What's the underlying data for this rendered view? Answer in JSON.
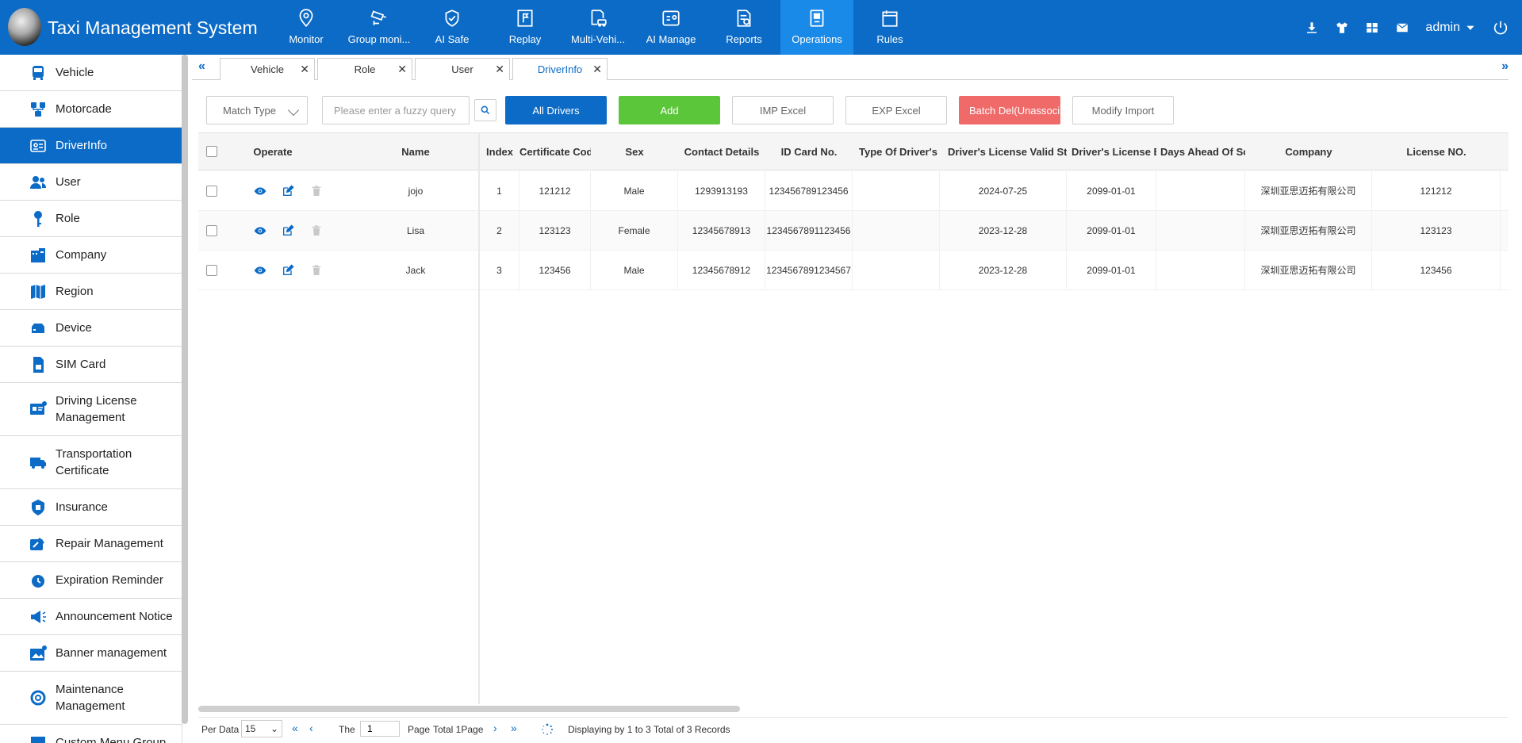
{
  "app": {
    "title": "Taxi Management System"
  },
  "nav": [
    {
      "label": "Monitor",
      "icon": "location-pin-icon"
    },
    {
      "label": "Group moni...",
      "icon": "cctv-camera-icon"
    },
    {
      "label": "AI Safe",
      "icon": "shield-check-icon"
    },
    {
      "label": "Replay",
      "icon": "replay-flag-icon"
    },
    {
      "label": "Multi-Vehi...",
      "icon": "vehicle-doc-icon"
    },
    {
      "label": "AI Manage",
      "icon": "ai-card-icon"
    },
    {
      "label": "Reports",
      "icon": "report-icon"
    },
    {
      "label": "Operations",
      "icon": "operations-icon",
      "active": true
    },
    {
      "label": "Rules",
      "icon": "rules-icon"
    }
  ],
  "header_right": {
    "user": "admin"
  },
  "sidebar": [
    {
      "label": "Vehicle",
      "icon": "bus-icon"
    },
    {
      "label": "Motorcade",
      "icon": "motorcade-icon"
    },
    {
      "label": "DriverInfo",
      "icon": "driver-card-icon",
      "active": true
    },
    {
      "label": "User",
      "icon": "users-icon"
    },
    {
      "label": "Role",
      "icon": "key-icon"
    },
    {
      "label": "Company",
      "icon": "company-icon"
    },
    {
      "label": "Region",
      "icon": "map-icon"
    },
    {
      "label": "Device",
      "icon": "device-icon"
    },
    {
      "label": "SIM Card",
      "icon": "sim-card-icon"
    },
    {
      "label": "Driving License Management",
      "icon": "license-icon"
    },
    {
      "label": "Transportation Certificate",
      "icon": "truck-certificate-icon"
    },
    {
      "label": "Insurance",
      "icon": "insurance-shield-icon"
    },
    {
      "label": "Repair Management",
      "icon": "wrench-icon"
    },
    {
      "label": "Expiration Reminder",
      "icon": "clock-icon"
    },
    {
      "label": "Announcement Notice",
      "icon": "megaphone-icon"
    },
    {
      "label": "Banner management",
      "icon": "banner-image-icon"
    },
    {
      "label": "Maintenance Management",
      "icon": "lifebuoy-icon"
    },
    {
      "label": "Custom Menu Group",
      "icon": "menu-group-icon"
    }
  ],
  "tabs": [
    {
      "label": "Vehicle"
    },
    {
      "label": "Role"
    },
    {
      "label": "User"
    },
    {
      "label": "DriverInfo",
      "active": true
    }
  ],
  "toolbar": {
    "match_type": "Match Type",
    "search_placeholder": "Please enter a fuzzy query",
    "all_drivers": "All Drivers",
    "add": "Add",
    "imp_excel": "IMP Excel",
    "exp_excel": "EXP Excel",
    "batch_del": "Batch Del(Unassociated)",
    "modify_import": "Modify Import"
  },
  "table": {
    "headers": {
      "operate": "Operate",
      "name": "Name",
      "index": "Index",
      "certificate": "Certificate Code",
      "sex": "Sex",
      "contact": "Contact Details",
      "id_card": "ID Card No.",
      "license_type": "Type Of Driver's License",
      "valid_start": "Driver's License Valid Start",
      "license_end": "Driver's License End",
      "days_ahead": "Days Ahead Of Schedule",
      "company": "Company",
      "license_no": "License NO."
    },
    "rows": [
      {
        "name": "jojo",
        "index": "1",
        "certificate": "121212",
        "sex": "Male",
        "contact": "1293913193",
        "id_card": "123456789123456",
        "license_type": "",
        "valid_start": "2024-07-25",
        "license_end": "2099-01-01",
        "days_ahead": "",
        "company": "深圳亚思迈拓有限公司",
        "license_no": "121212"
      },
      {
        "name": "Lisa",
        "index": "2",
        "certificate": "123123",
        "sex": "Female",
        "contact": "12345678913",
        "id_card": "1234567891123456",
        "license_type": "",
        "valid_start": "2023-12-28",
        "license_end": "2099-01-01",
        "days_ahead": "",
        "company": "深圳亚思迈拓有限公司",
        "license_no": "123123"
      },
      {
        "name": "Jack",
        "index": "3",
        "certificate": "123456",
        "sex": "Male",
        "contact": "12345678912",
        "id_card": "1234567891234567",
        "license_type": "",
        "valid_start": "2023-12-28",
        "license_end": "2099-01-01",
        "days_ahead": "",
        "company": "深圳亚思迈拓有限公司",
        "license_no": "123456"
      }
    ]
  },
  "pager": {
    "per_data": "Per Data",
    "per_value": "15",
    "the": "The",
    "page_value": "1",
    "page": "Page",
    "total": "Total 1Page",
    "status": "Displaying by 1 to 3 Total of 3 Records"
  },
  "colors": {
    "primary": "#0c6bc6",
    "active_nav": "#1a8ae8",
    "add_green": "#5cc63a",
    "delete_red": "#f06a6a"
  }
}
